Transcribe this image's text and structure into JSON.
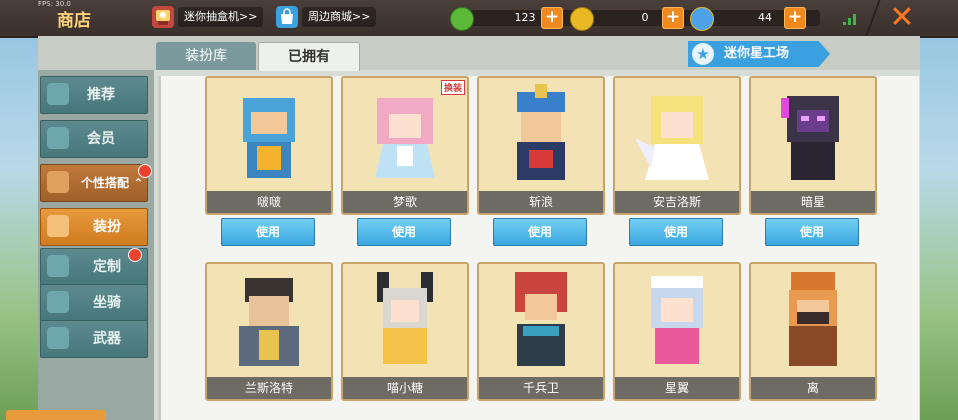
{
  "fps": "FPS: 30.0",
  "title": "商店",
  "top_links": [
    {
      "label": "迷你抽盒机>>"
    },
    {
      "label": "周边商城>>"
    }
  ],
  "currencies": [
    {
      "icon": "green-gem-icon",
      "value": "123",
      "color": "#5cb838"
    },
    {
      "icon": "gold-coin-icon",
      "value": "0",
      "color": "#e8b923"
    },
    {
      "icon": "mini-bean-icon",
      "value": "44",
      "color": "#4ea2e8"
    }
  ],
  "tabs": {
    "wardrobe": "装扮库",
    "owned": "已拥有"
  },
  "star_workshop": "迷你星工场",
  "sidebar": [
    {
      "label": "推荐"
    },
    {
      "label": "会员"
    },
    {
      "label": "个性搭配"
    },
    {
      "label": "装扮"
    },
    {
      "label": "定制"
    },
    {
      "label": "坐骑"
    },
    {
      "label": "武器"
    }
  ],
  "skins": [
    {
      "name": "啵啵",
      "color": "#4aa3d8"
    },
    {
      "name": "梦歌",
      "color": "#f2a9c4",
      "badge": "换装"
    },
    {
      "name": "斩浪",
      "color": "#3a7fc9"
    },
    {
      "name": "安吉洛斯",
      "color": "#f5e27a"
    },
    {
      "name": "暗星",
      "color": "#3b3348"
    },
    {
      "name": "兰斯洛特",
      "color": "#5d6a7c"
    },
    {
      "name": "喵小糖",
      "color": "#f6c34a"
    },
    {
      "name": "千兵卫",
      "color": "#c8443c"
    },
    {
      "name": "星翼",
      "color": "#c8d8ec"
    },
    {
      "name": "离",
      "color": "#d8782e"
    }
  ],
  "use_label": "使用"
}
